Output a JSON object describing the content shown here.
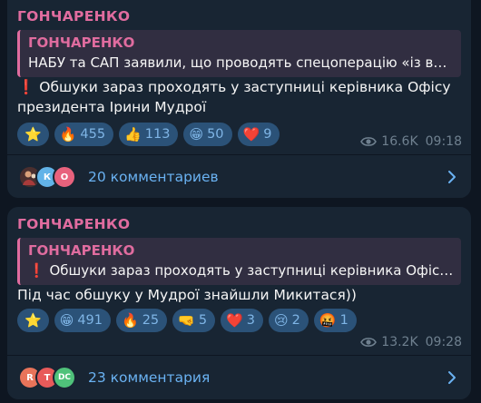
{
  "posts": [
    {
      "sender": "ГОНЧАРЕНКО",
      "quote": {
        "author": "ГОНЧАРЕНКО",
        "text": "НАБУ та САП заявили, що проводять спецоперацію «із вик..."
      },
      "text_line1": "Обшуки зараз проходять у заступниці керівника Офісу",
      "text_line2": "президента Ірини Мудрої",
      "reactions": [
        {
          "emoji": "⭐",
          "count": ""
        },
        {
          "emoji": "🔥",
          "count": "455"
        },
        {
          "emoji": "👍",
          "count": "113"
        },
        {
          "emoji": "😁",
          "count": "50"
        },
        {
          "emoji": "❤️",
          "count": "9"
        }
      ],
      "views": "16.6K",
      "time": "09:18",
      "comments_label": "20 комментариев",
      "avatars": [
        "",
        "К",
        "О"
      ]
    },
    {
      "sender": "ГОНЧАРЕНКО",
      "quote": {
        "author": "ГОНЧАРЕНКО",
        "text": "Обшуки зараз проходять у заступниці керівника Офісу ..."
      },
      "text_line1": "Під час обшуку у Мудрої знайшли Микитася))",
      "reactions": [
        {
          "emoji": "⭐",
          "count": ""
        },
        {
          "emoji": "😁",
          "count": "491"
        },
        {
          "emoji": "🔥",
          "count": "25"
        },
        {
          "emoji": "🤜",
          "count": "5"
        },
        {
          "emoji": "❤️",
          "count": "3"
        },
        {
          "emoji": "😢",
          "count": "2"
        },
        {
          "emoji": "🤬",
          "count": "1"
        }
      ],
      "views": "13.2K",
      "time": "09:28",
      "comments_label": "23 комментария",
      "avatars": [
        "R",
        "T",
        "DC"
      ]
    }
  ],
  "colors": {
    "background": "#0e1621",
    "bubble": "#182533",
    "accent_pink": "#e06c9f",
    "reaction_bg": "#2b5278",
    "link_blue": "#6ab2f2"
  },
  "icons": [
    "red-exclamation-icon",
    "eye-icon",
    "chevron-right-icon"
  ]
}
